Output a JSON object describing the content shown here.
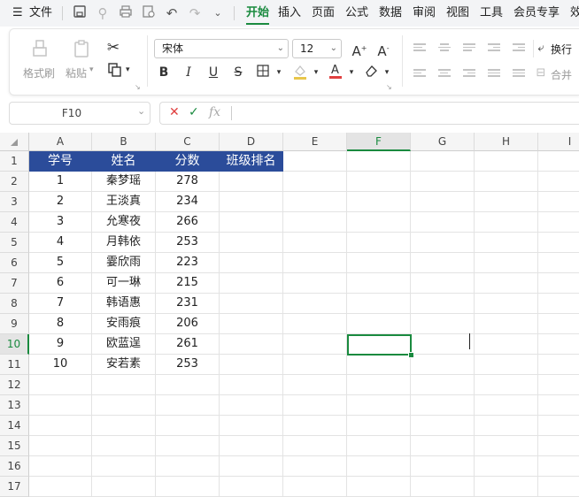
{
  "topbar": {
    "menu_label": "文件",
    "tabs": [
      "开始",
      "插入",
      "页面",
      "公式",
      "数据",
      "审阅",
      "视图",
      "工具",
      "会员专享",
      "效"
    ],
    "active_tab": "开始"
  },
  "ribbon": {
    "format_painter": "格式刷",
    "paste": "粘贴",
    "font_name": "宋体",
    "font_size": "12",
    "wrap_label": "换行",
    "merge_label": "合并",
    "bold": "B",
    "italic": "I",
    "underline": "U",
    "strike": "S"
  },
  "formula_bar": {
    "name_box": "F10",
    "fx_label": "fx",
    "value": ""
  },
  "columns": [
    "A",
    "B",
    "C",
    "D",
    "E",
    "F",
    "G",
    "H",
    "I"
  ],
  "rows": [
    "1",
    "2",
    "3",
    "4",
    "5",
    "6",
    "7",
    "8",
    "9",
    "10",
    "11",
    "12",
    "13",
    "14",
    "15",
    "16",
    "17"
  ],
  "sheet": {
    "headers": [
      "学号",
      "姓名",
      "分数",
      "班级排名"
    ],
    "data": [
      [
        "1",
        "秦梦瑶",
        "278",
        ""
      ],
      [
        "2",
        "王淡真",
        "234",
        ""
      ],
      [
        "3",
        "允寒夜",
        "266",
        ""
      ],
      [
        "4",
        "月韩依",
        "253",
        ""
      ],
      [
        "5",
        "霎欣雨",
        "223",
        ""
      ],
      [
        "6",
        "可一琳",
        "215",
        ""
      ],
      [
        "7",
        "韩语惠",
        "231",
        ""
      ],
      [
        "8",
        "安雨痕",
        "206",
        ""
      ],
      [
        "9",
        "欧蓝逞",
        "261",
        ""
      ],
      [
        "10",
        "安若素",
        "253",
        ""
      ]
    ]
  },
  "selection": {
    "column": "F",
    "row": "10"
  },
  "colors": {
    "accent": "#1a8a3f",
    "header_fill": "#2b4c9a",
    "cancel": "#e04040"
  }
}
